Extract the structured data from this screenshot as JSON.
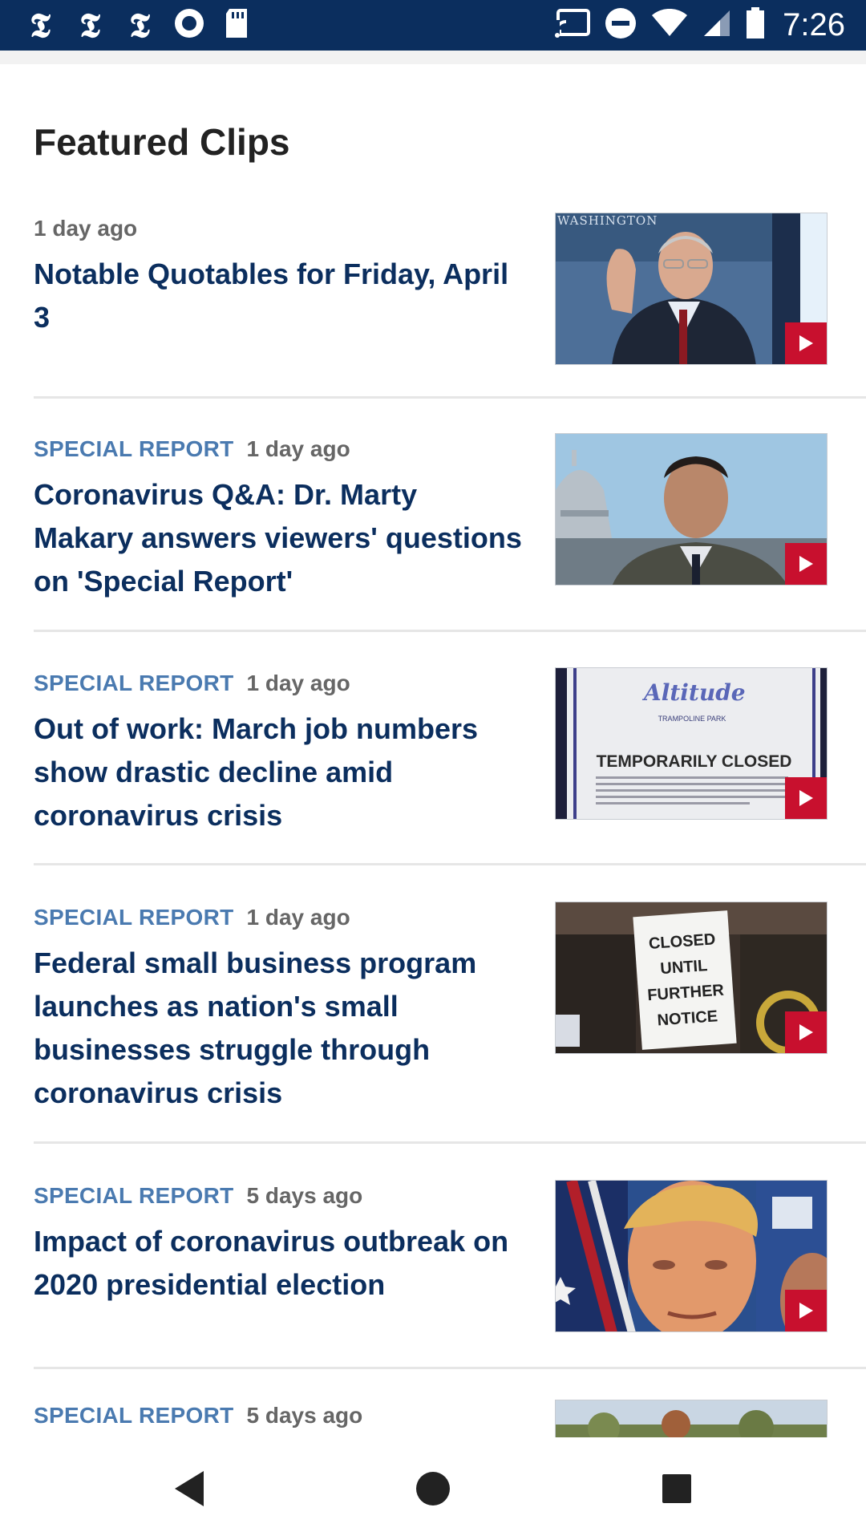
{
  "status_bar": {
    "time": "7:26",
    "left_icons": [
      "nyt-icon",
      "nyt-icon",
      "nyt-icon",
      "record-icon",
      "sd-card-icon"
    ],
    "right_icons": [
      "cast-icon",
      "do-not-disturb-icon",
      "wifi-icon",
      "cell-signal-icon",
      "battery-icon"
    ],
    "nyt_glyph": "𝕿"
  },
  "page": {
    "section_title": "Featured Clips"
  },
  "clips": [
    {
      "section": "",
      "time": "1 day ago",
      "title": "Notable Quotables for Friday, April 3",
      "thumb_caption": "WASHINGTON"
    },
    {
      "section": "SPECIAL REPORT",
      "time": "1 day ago",
      "title": "Coronavirus Q&A: Dr. Marty Makary answers viewers' questions on 'Special Report'"
    },
    {
      "section": "SPECIAL REPORT",
      "time": "1 day ago",
      "title": "Out of work: March job numbers show drastic decline amid coronavirus crisis",
      "thumb_sign": "TEMPORARILY CLOSED",
      "thumb_logo": "Altitude",
      "thumb_logo_sub": "TRAMPOLINE PARK"
    },
    {
      "section": "SPECIAL REPORT",
      "time": "1 day ago",
      "title": "Federal small business program launches as nation's small businesses struggle through coronavirus crisis",
      "thumb_sign_lines": [
        "CLOSED",
        "UNTIL",
        "FURTHER",
        "NOTICE"
      ]
    },
    {
      "section": "SPECIAL REPORT",
      "time": "5 days ago",
      "title": "Impact of coronavirus outbreak on 2020 presidential election"
    },
    {
      "section": "SPECIAL REPORT",
      "time": "5 days ago",
      "title": ""
    }
  ],
  "colors": {
    "status_bar": "#0b2e5e",
    "title": "#0b2e5e",
    "section_label": "#4a7ab0",
    "play_badge": "#c8102e"
  },
  "nav": {
    "icons": [
      "back-icon",
      "home-icon",
      "recents-icon"
    ]
  }
}
